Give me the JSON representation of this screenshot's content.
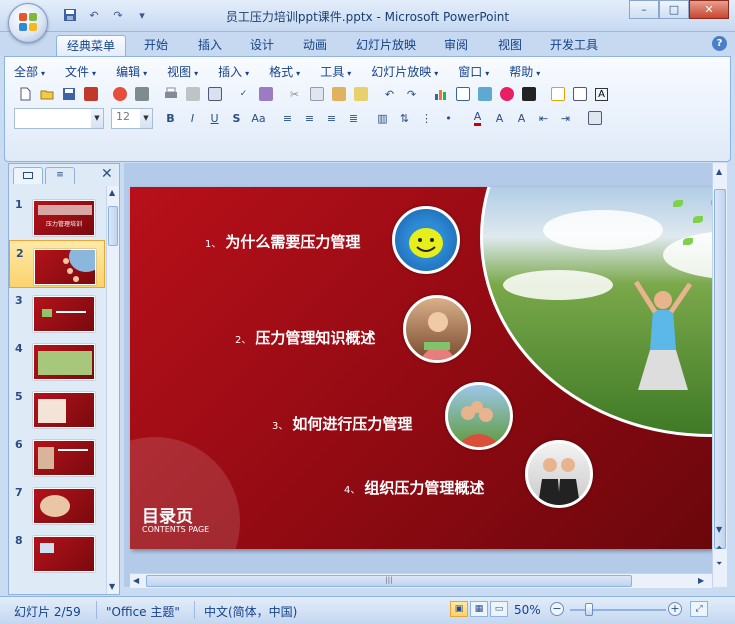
{
  "window": {
    "title": "员工压力培训ppt课件.pptx - Microsoft PowerPoint",
    "minimize": "–",
    "maximize": "□",
    "close": "✕"
  },
  "qat": {
    "save": "save-icon",
    "undo": "↶",
    "redo": "↷",
    "more": "▾"
  },
  "tabs": [
    "经典菜单",
    "开始",
    "插入",
    "设计",
    "动画",
    "幻灯片放映",
    "审阅",
    "视图",
    "开发工具"
  ],
  "active_tab": "经典菜单",
  "help": "?",
  "menus": [
    "全部",
    "文件",
    "编辑",
    "视图",
    "插入",
    "格式",
    "工具",
    "幻灯片放映",
    "窗口",
    "帮助"
  ],
  "font_size_value": "12",
  "slide_panel": {
    "numbers": [
      "1",
      "2",
      "3",
      "4",
      "5",
      "6",
      "7",
      "8"
    ],
    "selected": "2",
    "thumb1_title": "压力管理培训"
  },
  "slide": {
    "items": [
      {
        "num": "1、",
        "text": "为什么需要压力管理"
      },
      {
        "num": "2、",
        "text": "压力管理知识概述"
      },
      {
        "num": "3、",
        "text": "如何进行压力管理"
      },
      {
        "num": "4、",
        "text": "组织压力管理概述"
      }
    ],
    "toc_title": "目录页",
    "toc_subtitle": "CONTENTS PAGE"
  },
  "status": {
    "slide_info": "幻灯片 2/59",
    "theme": "\"Office 主题\"",
    "language": "中文(简体，中国)",
    "zoom": "50%",
    "zoom_out": "−",
    "zoom_in": "+"
  },
  "colors": {
    "accent": "#15428b",
    "slide_red": "#b8101a",
    "ribbon_bg": "#dfeaf8"
  }
}
